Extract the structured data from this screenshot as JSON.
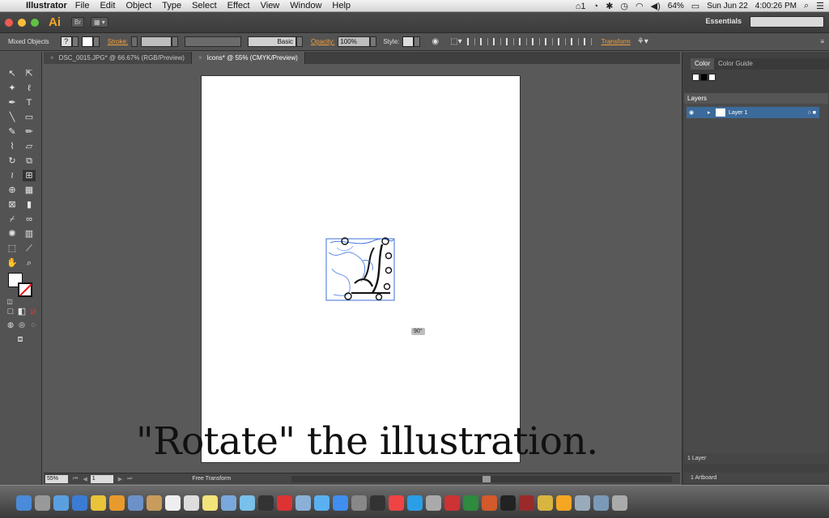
{
  "menubar": {
    "app_name": "Illustrator",
    "menus": [
      "File",
      "Edit",
      "Object",
      "Type",
      "Select",
      "Effect",
      "View",
      "Window",
      "Help"
    ],
    "battery": "64%",
    "date": "Sun Jun 22",
    "time": "4:00:26 PM",
    "adobe_count": "1"
  },
  "appbar": {
    "app_logo": "Ai",
    "bridge_label": "Br",
    "workspace": "Essentials"
  },
  "controlbar": {
    "selection": "Mixed Objects",
    "fill_symbol": "?",
    "stroke_label": "Stroke:",
    "brush_label": "Basic",
    "opacity_label": "Opacity:",
    "opacity_value": "100%",
    "style_label": "Style:",
    "transform_label": "Transform"
  },
  "tabs": [
    {
      "label": "DSC_0015.JPG* @ 66.67% (RGB/Preview)"
    },
    {
      "label": "Icons* @ 55% (CMYK/Preview)"
    }
  ],
  "canvas": {
    "rotation_tooltip": "90°"
  },
  "statusbar": {
    "zoom": "55%",
    "page": "1",
    "tool_status": "Free Transform"
  },
  "panels": {
    "color_tab": "Color",
    "color_guide_tab": "Color Guide",
    "layers_title": "Layers",
    "layer_name": "Layer 1",
    "layer_count": "1 Layer",
    "artboard_count": "1 Artboard"
  },
  "caption": "\"Rotate\" the illustration.",
  "colors": {
    "accent_orange": "#f0a040",
    "layer_highlight": "#3c6a9a"
  }
}
